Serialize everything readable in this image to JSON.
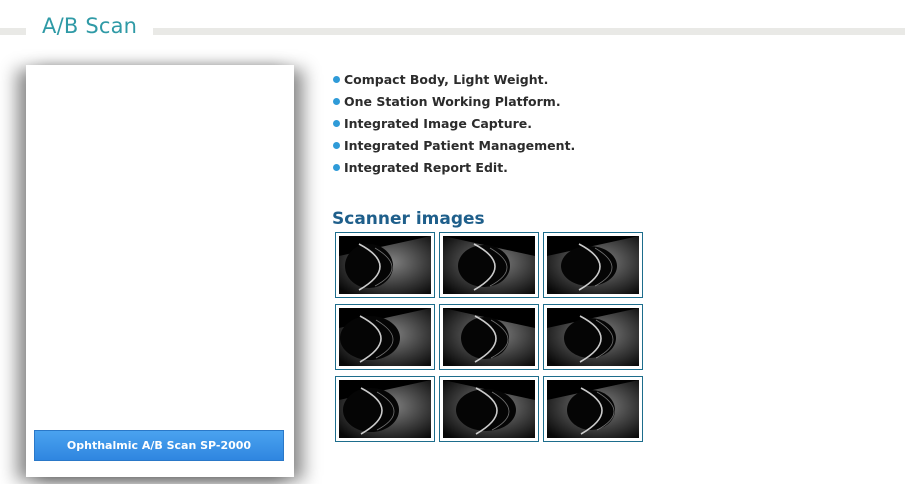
{
  "page": {
    "title": "A/B Scan"
  },
  "product": {
    "button_label": "Ophthalmic A/B Scan SP-2000"
  },
  "features": [
    "Compact Body, Light Weight.",
    "One Station Working Platform.",
    "Integrated Image Capture.",
    "Integrated Patient Management.",
    "Integrated Report Edit."
  ],
  "gallery": {
    "title": "Scanner images",
    "thumbnail_count": 9
  },
  "colors": {
    "title_teal": "#2f9aa6",
    "section_blue": "#1f5f8b",
    "bullet_blue": "#2f9bd8",
    "button_blue": "#3592e6",
    "thumb_border": "#1d6d8c"
  }
}
